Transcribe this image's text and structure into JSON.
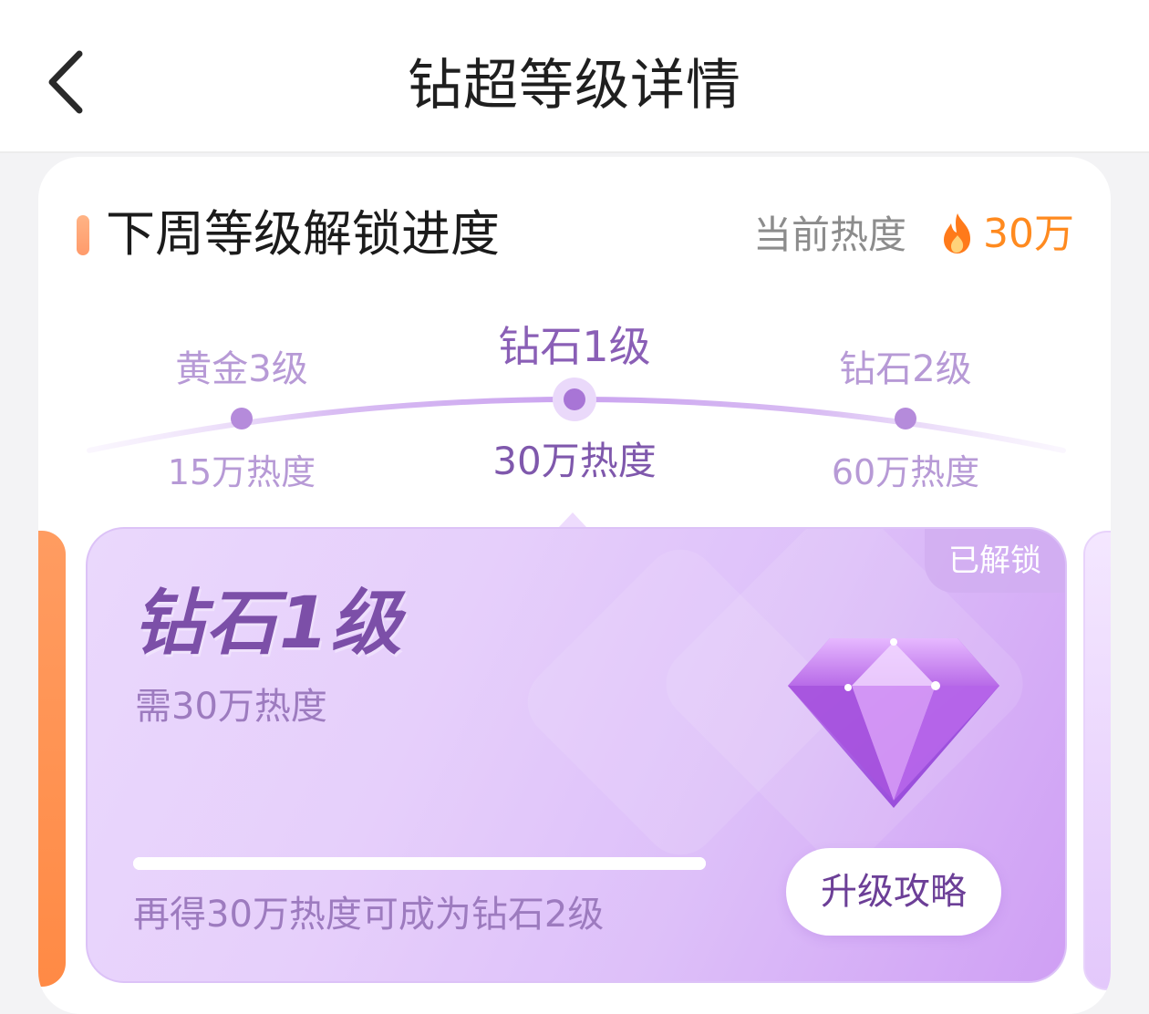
{
  "header": {
    "back_icon": "chevron-left-icon",
    "title": "钻超等级详情"
  },
  "progress_section": {
    "title": "下周等级解锁进度",
    "current_heat_label": "当前热度",
    "current_heat_icon": "fire-icon",
    "current_heat_value": "30万",
    "accent_color": "#ff8a1f"
  },
  "levels": [
    {
      "name": "黄金3级",
      "heat": "15万热度",
      "current": false
    },
    {
      "name": "钻石1级",
      "heat": "30万热度",
      "current": true
    },
    {
      "name": "钻石2级",
      "heat": "60万热度",
      "current": false
    }
  ],
  "level_card": {
    "badge": "已解锁",
    "title": "钻石1级",
    "requirement": "需30万热度",
    "icon": "diamond-icon",
    "progress_fraction": 1.0,
    "footer_text": "再得30万热度可成为钻石2级",
    "upgrade_button": "升级攻略"
  }
}
